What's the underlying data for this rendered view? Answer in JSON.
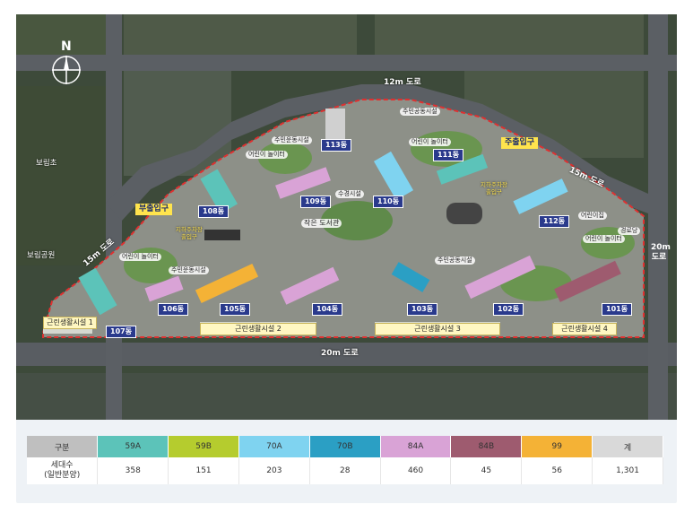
{
  "compass": {
    "label": "N"
  },
  "roads": {
    "north": "12m 도로",
    "northeast": "15m 도로",
    "west": "15m 도로",
    "south": "20m 도로",
    "east_line1": "20m",
    "east_line2": "도로"
  },
  "places": {
    "school": "보림초",
    "park": "보림공원",
    "library": "작은 도서관",
    "senior_center": "경로당",
    "daycare": "어린이집"
  },
  "entrances": {
    "main": "주출입구",
    "sub": "부출입구"
  },
  "parking_entrance": {
    "line1": "지하주차장",
    "line2": "출입구"
  },
  "buildings": [
    "101동",
    "102동",
    "103동",
    "104동",
    "105동",
    "106동",
    "107동",
    "108동",
    "109동",
    "110동",
    "111동",
    "112동",
    "113동"
  ],
  "facilities": {
    "community_top": "주민공동시설",
    "community_mid": "주민공동시설",
    "community_left": "주민운동시설",
    "fitness_top": "주민운동시설",
    "fitness_right": "주민운동시설",
    "playground": "어린이 놀이터",
    "water_feature": "수경시설"
  },
  "commercial": [
    "근린생활시설 1",
    "근린생활시설 2",
    "근린생활시설 3",
    "근린생활시설 4"
  ],
  "colors": {
    "59A": "#5cc3b9",
    "59B": "#b5cc2e",
    "70A": "#7fd3f0",
    "70B": "#2b9fc4",
    "84A": "#d9a3d6",
    "84B": "#9e5b6f",
    "99": "#f4b236",
    "total": "#d9d9d9",
    "header_gray": "#bfbfbf"
  },
  "unit_table": {
    "header_label": "구분",
    "row_label_line1": "세대수",
    "row_label_line2": "(일반분양)",
    "types": [
      "59A",
      "59B",
      "70A",
      "70B",
      "84A",
      "84B",
      "99",
      "계"
    ],
    "counts": [
      "358",
      "151",
      "203",
      "28",
      "460",
      "45",
      "56",
      "1,301"
    ]
  }
}
